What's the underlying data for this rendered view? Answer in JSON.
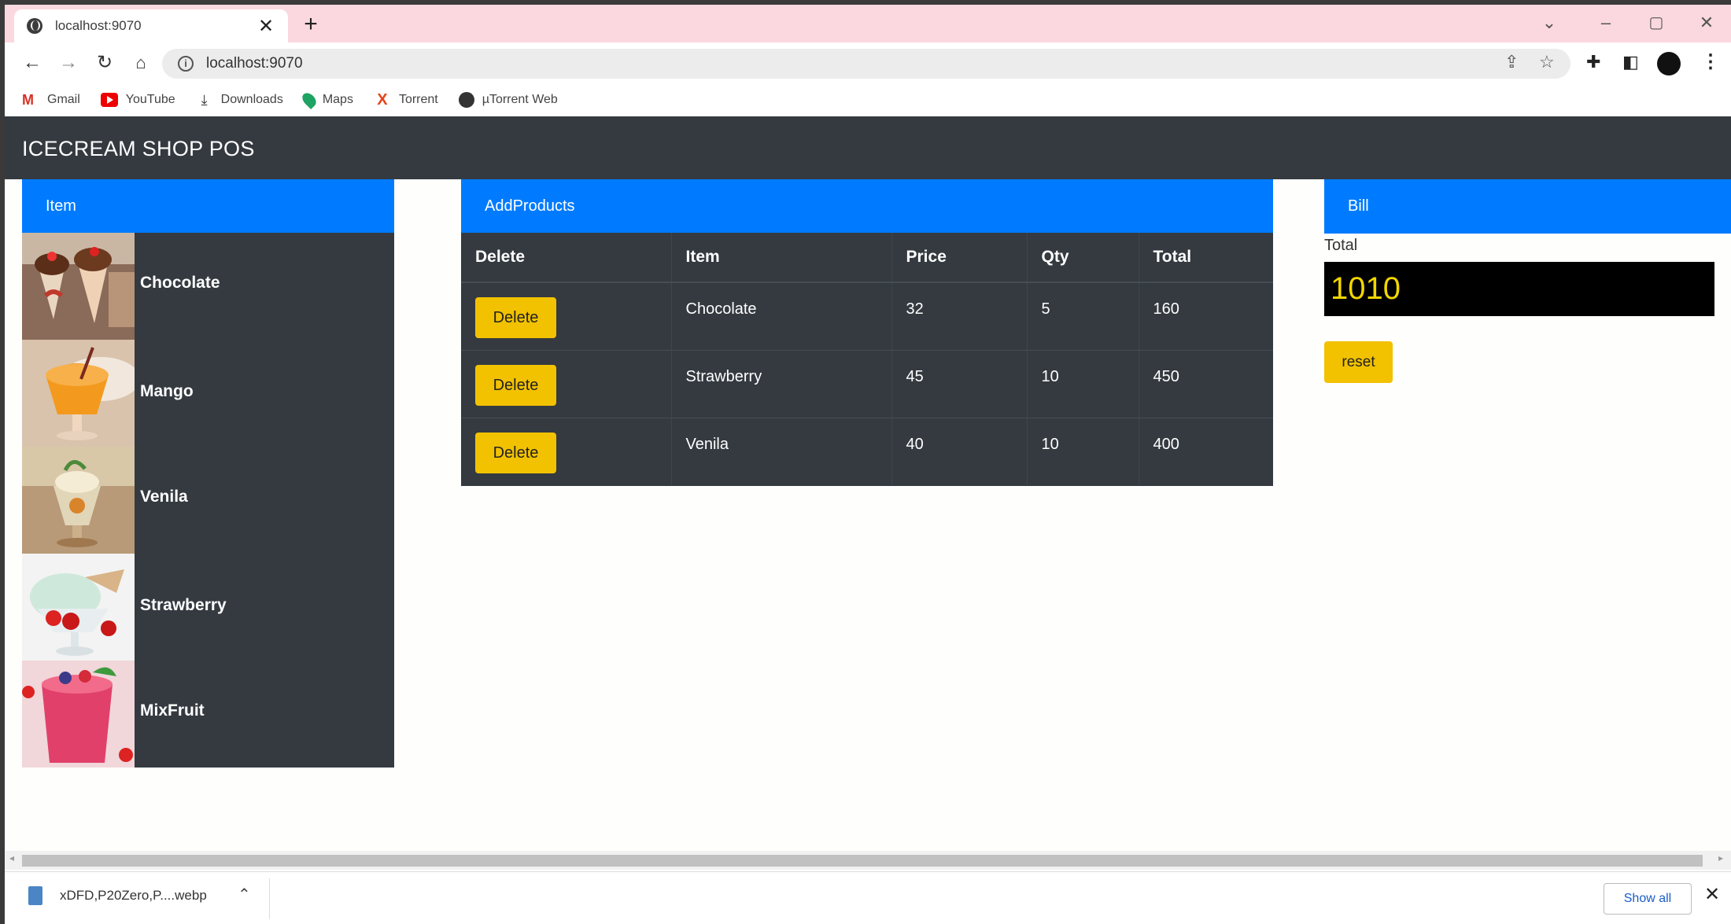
{
  "browser": {
    "tab_title": "localhost:9070",
    "tab_close": "✕",
    "new_tab": "+",
    "url": "localhost:9070",
    "bookmarks": [
      {
        "label": "Gmail",
        "icon": "gmail-icon"
      },
      {
        "label": "YouTube",
        "icon": "youtube-icon"
      },
      {
        "label": "Downloads",
        "icon": "download-icon"
      },
      {
        "label": "Maps",
        "icon": "maps-icon"
      },
      {
        "label": "Torrent",
        "icon": "torrent-icon"
      },
      {
        "label": "µTorrent Web",
        "icon": "utorrent-icon"
      }
    ]
  },
  "app": {
    "title": "ICECREAM SHOP POS"
  },
  "items_panel": {
    "header": "Item",
    "items": [
      {
        "name": "Chocolate"
      },
      {
        "name": "Mango"
      },
      {
        "name": "Venila"
      },
      {
        "name": "Strawberry"
      },
      {
        "name": "MixFruit"
      }
    ]
  },
  "products": {
    "header": "AddProducts",
    "columns": [
      "Delete",
      "Item",
      "Price",
      "Qty",
      "Total"
    ],
    "delete_label": "Delete",
    "rows": [
      {
        "item": "Chocolate",
        "price": "32",
        "qty": "5",
        "total": "160"
      },
      {
        "item": "Strawberry",
        "price": "45",
        "qty": "10",
        "total": "450"
      },
      {
        "item": "Venila",
        "price": "40",
        "qty": "10",
        "total": "400"
      }
    ]
  },
  "bill": {
    "header": "Bill",
    "total_label": "Total",
    "total_value": "1010",
    "reset_label": "reset"
  },
  "downloads": {
    "file_name": "xDFD,P20Zero,P....webp",
    "show_all": "Show all"
  },
  "colors": {
    "primary": "#007bff",
    "dark": "#343a40",
    "warning": "#f2c200",
    "total_text": "#f2d600"
  }
}
